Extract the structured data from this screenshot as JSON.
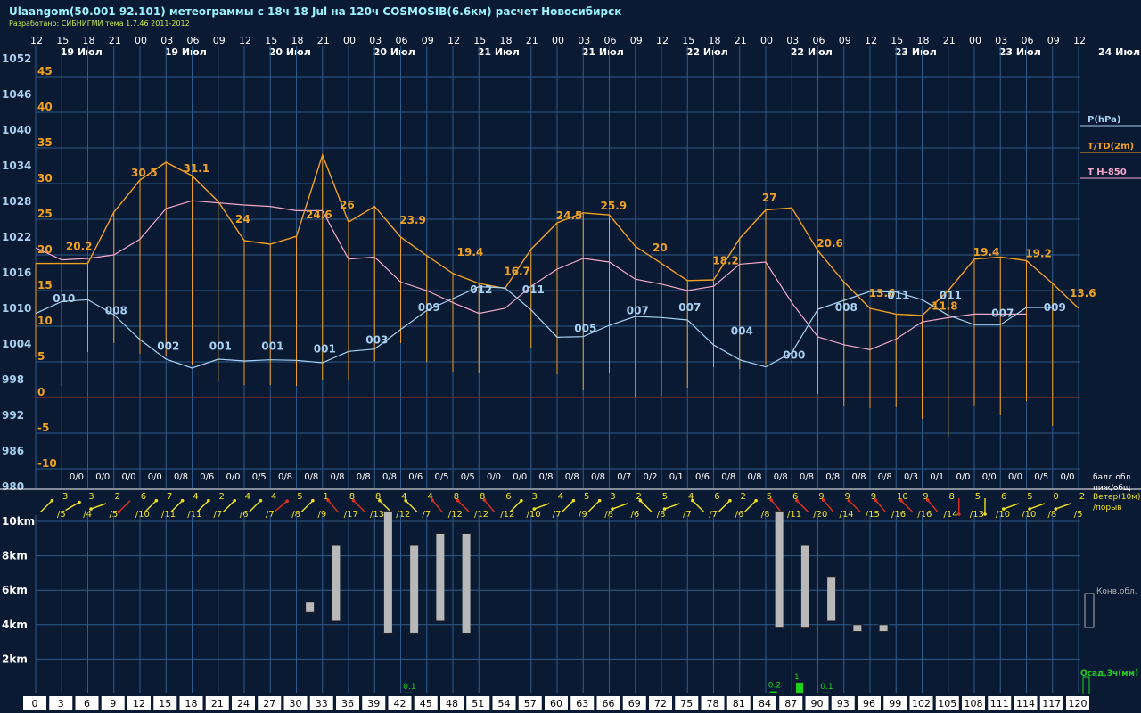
{
  "header": {
    "title": "Ulaangom(50.001 92.101) метеограммы с  18ч 18 Jul на 120ч COSMOSIB(6.6км) расчет Новосибирск",
    "subtitle": "Разработано: СИБНИГМИ тема 1.7.46 2011-2012"
  },
  "chart_data": {
    "type": "line",
    "hour_ticks": [
      "12",
      "15",
      "18",
      "21",
      "00",
      "03",
      "06",
      "09",
      "12",
      "15",
      "18",
      "21",
      "00",
      "03",
      "06",
      "09",
      "12",
      "15",
      "18",
      "21",
      "00",
      "03",
      "06",
      "09",
      "12",
      "15",
      "18",
      "21",
      "00",
      "03",
      "06",
      "09",
      "12",
      "15",
      "18",
      "21",
      "00",
      "03",
      "06",
      "09",
      "12"
    ],
    "date_labels": [
      {
        "i": 1,
        "text": "19 Июл"
      },
      {
        "i": 5,
        "text": "19 Июл"
      },
      {
        "i": 9,
        "text": "20 Июл"
      },
      {
        "i": 13,
        "text": "20 Июл"
      },
      {
        "i": 17,
        "text": "21 Июл"
      },
      {
        "i": 21,
        "text": "21 Июл"
      },
      {
        "i": 25,
        "text": "22 Июл"
      },
      {
        "i": 29,
        "text": "22 Июл"
      },
      {
        "i": 33,
        "text": "23 Июл"
      },
      {
        "i": 37,
        "text": "23 Июл"
      }
    ],
    "end_date": "24 Июл",
    "x_hours": [
      0,
      3,
      6,
      9,
      12,
      15,
      18,
      21,
      24,
      27,
      30,
      33,
      36,
      39,
      42,
      45,
      48,
      51,
      54,
      57,
      60,
      63,
      66,
      69,
      72,
      75,
      78,
      81,
      84,
      87,
      90,
      93,
      96,
      99,
      102,
      105,
      108,
      111,
      114,
      117,
      120
    ],
    "pressure_ticks": [
      "1052",
      "1046",
      "1040",
      "1034",
      "1028",
      "1022",
      "1016",
      "1010",
      "1004",
      "998",
      "992",
      "986",
      "980"
    ],
    "temp_ticks": [
      "45",
      "40",
      "35",
      "30",
      "25",
      "20",
      "15",
      "10",
      "5",
      "0",
      "-5",
      "-10"
    ],
    "temperature": [
      18.8,
      18.8,
      18.8,
      26.0,
      30.5,
      33.0,
      31.1,
      27.5,
      22.0,
      21.5,
      22.6,
      34.0,
      24.6,
      26.8,
      22.5,
      19.9,
      17.4,
      16.0,
      15.3,
      20.8,
      24.5,
      25.9,
      25.6,
      21.2,
      18.8,
      16.4,
      16.5,
      22.3,
      26.3,
      26.6,
      20.6,
      16.2,
      12.5,
      11.7,
      11.5,
      15.0,
      19.4,
      19.7,
      19.2,
      16.0,
      12.5
    ],
    "t850": [
      21,
      19.3,
      19.5,
      20,
      22.2,
      26.5,
      27.6,
      27.3,
      27,
      26.8,
      26.2,
      26.2,
      19.4,
      19.7,
      16.2,
      15,
      13.3,
      11.8,
      12.5,
      15.6,
      18,
      19.5,
      19,
      16.6,
      15.9,
      15,
      15.6,
      18.7,
      19,
      13.3,
      8.5,
      7.4,
      6.7,
      8.2,
      10.6,
      11.2,
      11.7,
      11.7,
      11.7
    ],
    "pressure": [
      1009,
      1011,
      1011.3,
      1008.8,
      1004.6,
      1001.3,
      999.8,
      1001.3,
      1001,
      1001.2,
      1001.1,
      1000.7,
      1002.6,
      1003,
      1006.3,
      1009.5,
      1011.5,
      1013.5,
      1013.3,
      1009.6,
      1005,
      1005.1,
      1007,
      1008.5,
      1008.3,
      1007.9,
      1003.7,
      1001.2,
      1000,
      1002.4,
      1009.7,
      1011.2,
      1012.7,
      1012.6,
      1011.3,
      1008.7,
      1007.1,
      1007.1,
      1010,
      1010
    ],
    "value_labels": [
      {
        "text": "20.2",
        "x": 1.5,
        "y": 20.2
      },
      {
        "text": "30.5",
        "x": 4,
        "y": 30.5
      },
      {
        "text": "31.1",
        "x": 6,
        "y": 31.1
      },
      {
        "text": "24",
        "x": 8,
        "y": 24
      },
      {
        "text": "24.6",
        "x": 10.7,
        "y": 24.6
      },
      {
        "text": "26",
        "x": 12,
        "y": 26
      },
      {
        "text": "23.9",
        "x": 14.3,
        "y": 23.9
      },
      {
        "text": "19.4",
        "x": 16.5,
        "y": 19.4
      },
      {
        "text": "16.7",
        "x": 18.3,
        "y": 16.7
      },
      {
        "text": "24.5",
        "x": 20.3,
        "y": 24.5
      },
      {
        "text": "25.9",
        "x": 22,
        "y": 25.9
      },
      {
        "text": "20",
        "x": 24,
        "y": 20
      },
      {
        "text": "18.2",
        "x": 26.3,
        "y": 18.2
      },
      {
        "text": "27",
        "x": 28.2,
        "y": 27
      },
      {
        "text": "20.6",
        "x": 30.3,
        "y": 20.6
      },
      {
        "text": "13.6",
        "x": 32.3,
        "y": 13.6
      },
      {
        "text": "11.8",
        "x": 34.7,
        "y": 11.8
      },
      {
        "text": "19.4",
        "x": 36.3,
        "y": 19.4
      },
      {
        "text": "19.2",
        "x": 38.3,
        "y": 19.2
      },
      {
        "text": "13.6",
        "x": 40,
        "y": 13.6
      }
    ],
    "pressure_labels": [
      {
        "text": "010",
        "x": 1,
        "p": 1010
      },
      {
        "text": "008",
        "x": 3,
        "p": 1008
      },
      {
        "text": "002",
        "x": 5,
        "p": 1002
      },
      {
        "text": "001",
        "x": 7,
        "p": 1002
      },
      {
        "text": "001",
        "x": 9,
        "p": 1002
      },
      {
        "text": "001",
        "x": 11,
        "p": 1001.5
      },
      {
        "text": "003",
        "x": 13,
        "p": 1003
      },
      {
        "text": "009",
        "x": 15,
        "p": 1008.5
      },
      {
        "text": "012",
        "x": 17,
        "p": 1011.5
      },
      {
        "text": "011",
        "x": 19,
        "p": 1011.5
      },
      {
        "text": "005",
        "x": 21,
        "p": 1005
      },
      {
        "text": "007",
        "x": 23,
        "p": 1008
      },
      {
        "text": "007",
        "x": 25,
        "p": 1008.5
      },
      {
        "text": "004",
        "x": 27,
        "p": 1004.5
      },
      {
        "text": "000",
        "x": 29,
        "p": 1000.5
      },
      {
        "text": "008",
        "x": 31,
        "p": 1008.5
      },
      {
        "text": "011",
        "x": 33,
        "p": 1010.5
      },
      {
        "text": "011",
        "x": 35,
        "p": 1010.5
      },
      {
        "text": "007",
        "x": 37,
        "p": 1007.5
      },
      {
        "text": "009",
        "x": 39,
        "p": 1008.5
      }
    ],
    "cloud_labels": [
      "0/0",
      "0/0",
      "0/0",
      "0/0",
      "0/8",
      "0/6",
      "0/0",
      "0/5",
      "0/8",
      "0/8",
      "0/8",
      "0/8",
      "0/8",
      "0/6",
      "0/5",
      "0/5",
      "0/0",
      "0/0",
      "0/8",
      "0/8",
      "0/8",
      "0/7",
      "0/2",
      "0/1",
      "0/6",
      "0/8",
      "0/8",
      "0/8",
      "0/8",
      "0/8",
      "0/8",
      "0/8",
      "0/3",
      "0/1",
      "0/0",
      "0/0",
      "0/0",
      "0/5",
      "0/0"
    ],
    "wind_top": [
      "3",
      "3",
      "2",
      "6",
      "7",
      "4",
      "2",
      "4",
      "4",
      "5",
      "1",
      "8",
      "8",
      "4",
      "4",
      "8",
      "8",
      "6",
      "3",
      "4",
      "5",
      "3",
      "2",
      "5",
      "4",
      "6",
      "2",
      "5",
      "6",
      "9",
      "9",
      "9",
      "10",
      "9",
      "8",
      "5",
      "6",
      "5",
      "0",
      "2"
    ],
    "wind_bottom": [
      "/5",
      "/4",
      "/5",
      "/10",
      "/11",
      "/11",
      "/7",
      "/6",
      "/7",
      "/8",
      "/9",
      "/17",
      "/13",
      "/12",
      "/7",
      "/12",
      "/12",
      "/12",
      "/10",
      "/7",
      "/9",
      "/8",
      "/6",
      "/8",
      "/7",
      "/7",
      "/6",
      "/8",
      "/11",
      "/20",
      "/14",
      "/15",
      "/16",
      "/16",
      "/14",
      "/13",
      "/10",
      "/10",
      "/8",
      "/5"
    ],
    "wind_dirs": [
      45,
      30,
      200,
      225,
      45,
      45,
      45,
      45,
      45,
      40,
      45,
      130,
      135,
      135,
      135,
      130,
      135,
      130,
      45,
      200,
      45,
      45,
      200,
      135,
      200,
      135,
      45,
      45,
      130,
      135,
      130,
      135,
      130,
      135,
      130,
      270,
      270,
      200,
      200,
      200
    ],
    "wind_red": [
      false,
      false,
      false,
      true,
      false,
      false,
      false,
      false,
      false,
      true,
      false,
      true,
      true,
      false,
      false,
      true,
      true,
      true,
      false,
      false,
      false,
      false,
      false,
      false,
      false,
      false,
      false,
      false,
      true,
      true,
      true,
      true,
      true,
      true,
      true,
      true,
      false,
      false,
      false,
      false
    ],
    "conv_bars": [
      {
        "i": 10.5,
        "lo": 4.7,
        "hi": 5.3
      },
      {
        "i": 11.5,
        "lo": 4.2,
        "hi": 8.6
      },
      {
        "i": 13.5,
        "lo": 3.5,
        "hi": 10.6
      },
      {
        "i": 14.5,
        "lo": 3.5,
        "hi": 8.6
      },
      {
        "i": 15.5,
        "lo": 4.2,
        "hi": 9.3
      },
      {
        "i": 16.5,
        "lo": 3.5,
        "hi": 9.3
      },
      {
        "i": 28.5,
        "lo": 3.8,
        "hi": 10.6
      },
      {
        "i": 29.5,
        "lo": 3.8,
        "hi": 8.6
      },
      {
        "i": 30.5,
        "lo": 4.2,
        "hi": 6.8
      },
      {
        "i": 31.5,
        "lo": 3.6,
        "hi": 4.0
      },
      {
        "i": 32.5,
        "lo": 3.6,
        "hi": 4.0
      }
    ],
    "precip": [
      {
        "i": 14.3,
        "text": "0.1",
        "v": 0.1
      },
      {
        "i": 28.3,
        "text": "0.2",
        "v": 0.2
      },
      {
        "i": 29.3,
        "text": "1",
        "v": 1
      },
      {
        "i": 30.3,
        "text": "0.1",
        "v": 0.1
      }
    ],
    "height_ticks": [
      "10km",
      "8km",
      "6km",
      "4km",
      "2km"
    ],
    "bottom_hours": [
      "0",
      "3",
      "6",
      "9",
      "12",
      "15",
      "18",
      "21",
      "24",
      "27",
      "30",
      "33",
      "36",
      "39",
      "42",
      "45",
      "48",
      "51",
      "54",
      "57",
      "60",
      "63",
      "66",
      "69",
      "72",
      "75",
      "78",
      "81",
      "84",
      "87",
      "90",
      "93",
      "96",
      "99",
      "102",
      "105",
      "108",
      "111",
      "114",
      "117",
      "120"
    ],
    "legend": {
      "p": "P(hPa)",
      "t": "T/TD(2m)",
      "t850": "T H-850",
      "clouds1": "балл обл.",
      "clouds2": "ниж/общ",
      "wind1": "Ветер(10м)",
      "wind2": "/порыв",
      "conv": "Конв.обл.",
      "precip": "Осад,3ч(мм)"
    },
    "colors": {
      "bg": "#0a1a33",
      "grid": "#2e5a8a",
      "temp": "#f0a020",
      "t850": "#f4a7c8",
      "pressure": "#a8d0f0",
      "yellow": "#f0e020",
      "red": "#e03020",
      "zero": "#8a3030",
      "green": "#20d020"
    }
  }
}
